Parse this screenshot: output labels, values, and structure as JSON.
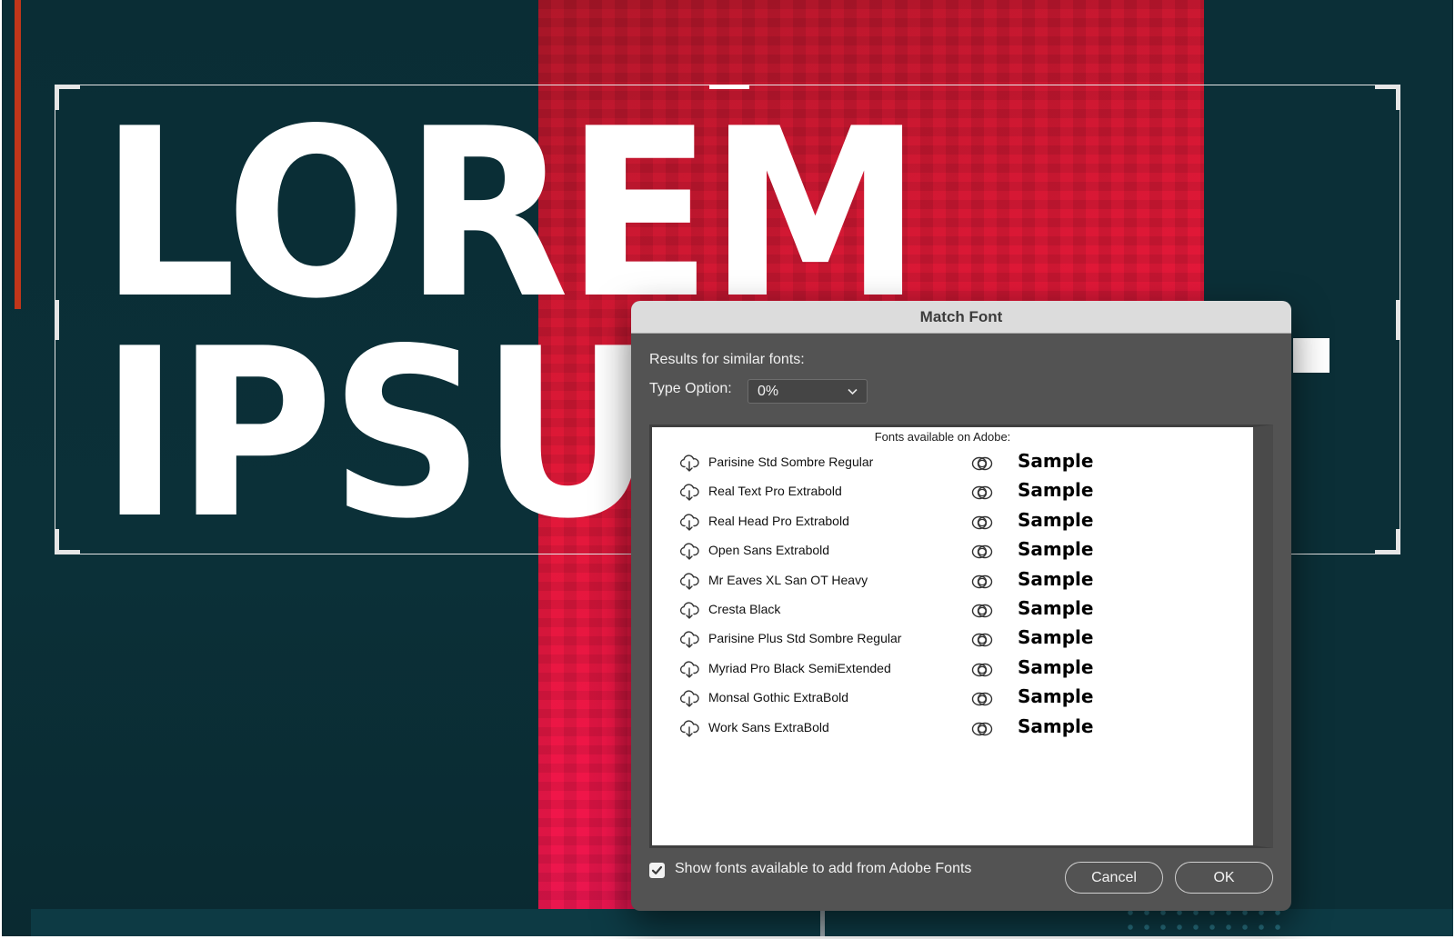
{
  "artwork": {
    "headline_line1": "LOREM",
    "headline_line2": "IPSU"
  },
  "dialog": {
    "title": "Match Font",
    "results_label": "Results for similar fonts:",
    "type_option_label": "Type Option:",
    "type_option_value": "0%",
    "list_header": "Fonts available on Adobe:",
    "fonts": [
      {
        "name": "Parisine Std Sombre Regular",
        "sample": "Sample"
      },
      {
        "name": "Real Text Pro Extrabold",
        "sample": "Sample"
      },
      {
        "name": "Real Head Pro Extrabold",
        "sample": "Sample"
      },
      {
        "name": "Open Sans Extrabold",
        "sample": "Sample"
      },
      {
        "name": "Mr Eaves XL San OT Heavy",
        "sample": "Sample"
      },
      {
        "name": "Cresta Black",
        "sample": "Sample"
      },
      {
        "name": "Parisine Plus Std Sombre Regular",
        "sample": "Sample"
      },
      {
        "name": "Myriad Pro Black SemiExtended",
        "sample": "Sample"
      },
      {
        "name": "Monsal Gothic ExtraBold",
        "sample": "Sample"
      },
      {
        "name": "Work Sans ExtraBold",
        "sample": "Sample"
      }
    ],
    "show_fonts_checkbox": {
      "label": "Show fonts available to add from Adobe Fonts",
      "checked": true
    },
    "cancel_label": "Cancel",
    "ok_label": "OK"
  },
  "icons": {
    "row_download": "cloud-download-icon",
    "row_creative_cloud": "creative-cloud-icon",
    "select_caret": "chevron-down-icon",
    "checkbox": "checkmark-icon"
  },
  "colors": {
    "canvas_dark": "#0a2f37",
    "canvas_red": "#e01837",
    "dialog_bg": "#535353",
    "titlebar_bg": "#dcdcdc",
    "accent_orange": "#c0361a"
  }
}
